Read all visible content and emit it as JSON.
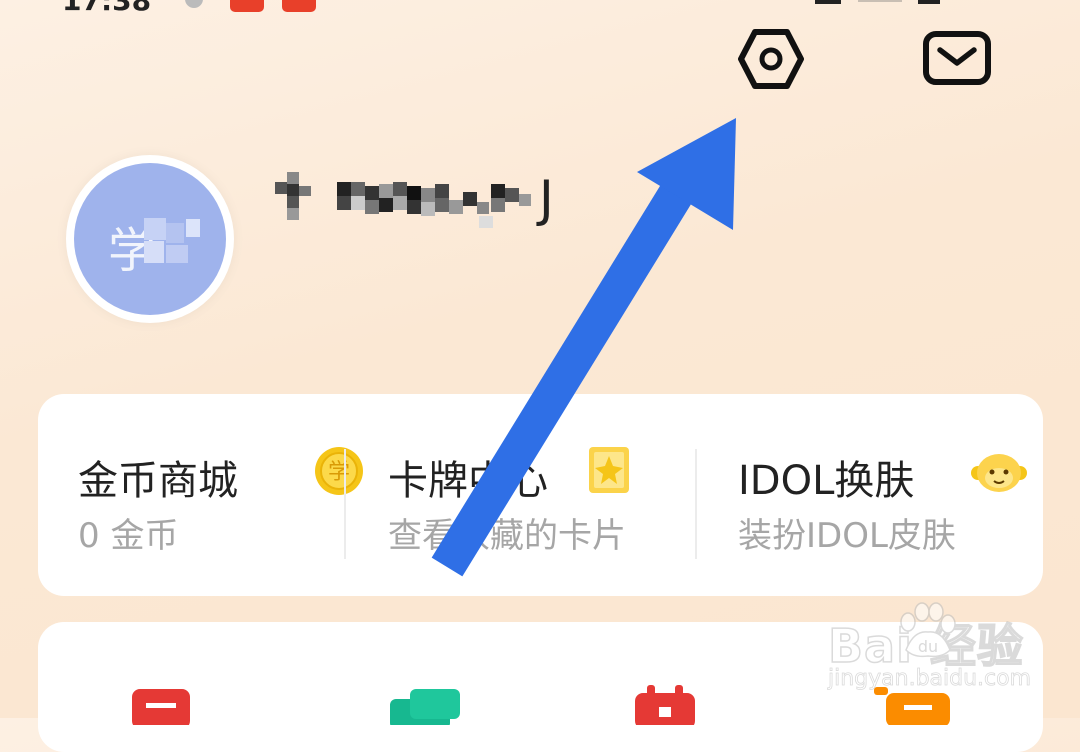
{
  "status_bar": {
    "time": "17:38"
  },
  "header": {
    "settings_icon": "settings-hexagon-icon",
    "mail_icon": "mail-envelope-icon"
  },
  "profile": {
    "avatar_char": "学",
    "username_visible": "J"
  },
  "quick_cards": [
    {
      "title": "金币商城",
      "subtitle": "0 金币",
      "icon": "coin-icon"
    },
    {
      "title": "卡牌中心",
      "subtitle": "查看收藏的卡片",
      "icon": "cards-icon"
    },
    {
      "title": "IDOL换肤",
      "subtitle": "装扮IDOL皮肤",
      "icon": "idol-skin-icon"
    }
  ],
  "watermark": {
    "logo": "Bai  经验",
    "url": "jingyan.baidu.com"
  },
  "colors": {
    "accent_blue": "#2f6fe6",
    "coin_yellow": "#f5c518",
    "brand_red": "#e8402a"
  }
}
